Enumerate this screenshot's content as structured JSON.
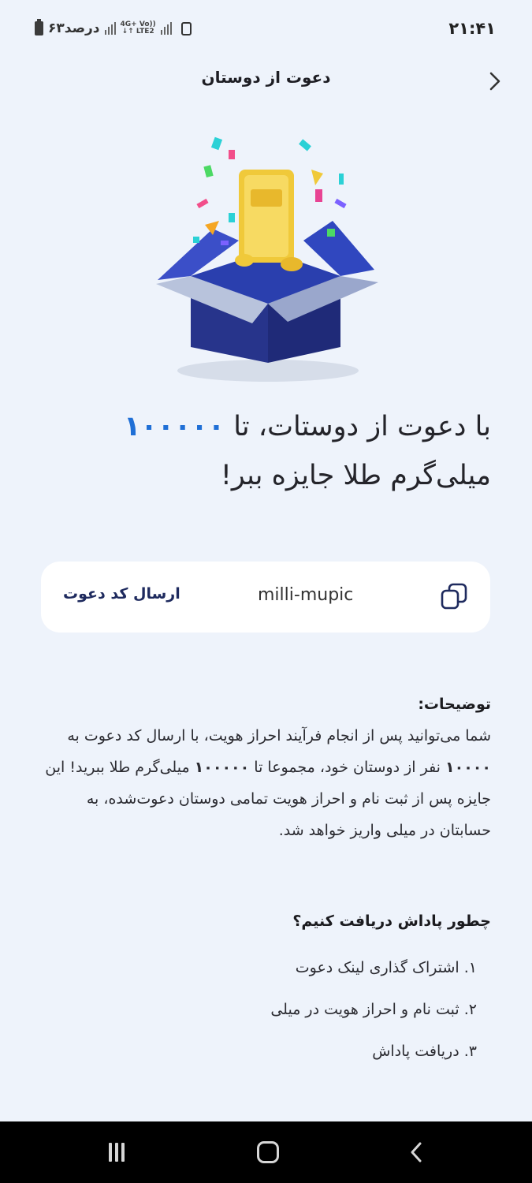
{
  "status_bar": {
    "time": "۲۱:۴۱",
    "battery": "۶۳درصد",
    "network": "4G+ Vo)) LTE2"
  },
  "header": {
    "title": "دعوت از دوستان"
  },
  "hero": {
    "icon": "gift-box-gold-bar-illustration"
  },
  "headline": {
    "part1": "با دعوت از دوستات، تا ",
    "amount": "۱۰۰۰۰۰",
    "part2": "میلی‌گرم طلا جایزه ببر!"
  },
  "invite": {
    "send_label": "ارسال کد دعوت",
    "code": "milli-mupic",
    "copy_icon": "copy-icon"
  },
  "description": {
    "title": "توضیحات:",
    "seg1": "شما می‌توانید پس از انجام فرآیند احراز هویت، با ارسال کد دعوت به ",
    "count": "۱۰۰۰۰",
    "seg2": " نفر از دوستان خود، مجموعا تا ",
    "amount": "۱۰۰۰۰۰",
    "seg3": " میلی‌گرم طلا ببرید! این جایزه پس از ثبت نام و احراز هویت تمامی دوستان دعوت‌شده، به حسابتان در میلی واریز خواهد شد."
  },
  "how": {
    "title": "چطور پاداش دریافت کنیم؟",
    "steps": [
      "۱. اشتراک گذاری لینک دعوت",
      "۲. ثبت نام و احراز هویت در میلی",
      "۳. دریافت پاداش"
    ]
  },
  "colors": {
    "background": "#eef3fb",
    "accent": "#1f6fd6",
    "card": "#ffffff",
    "send_text": "#1e2a5e"
  }
}
